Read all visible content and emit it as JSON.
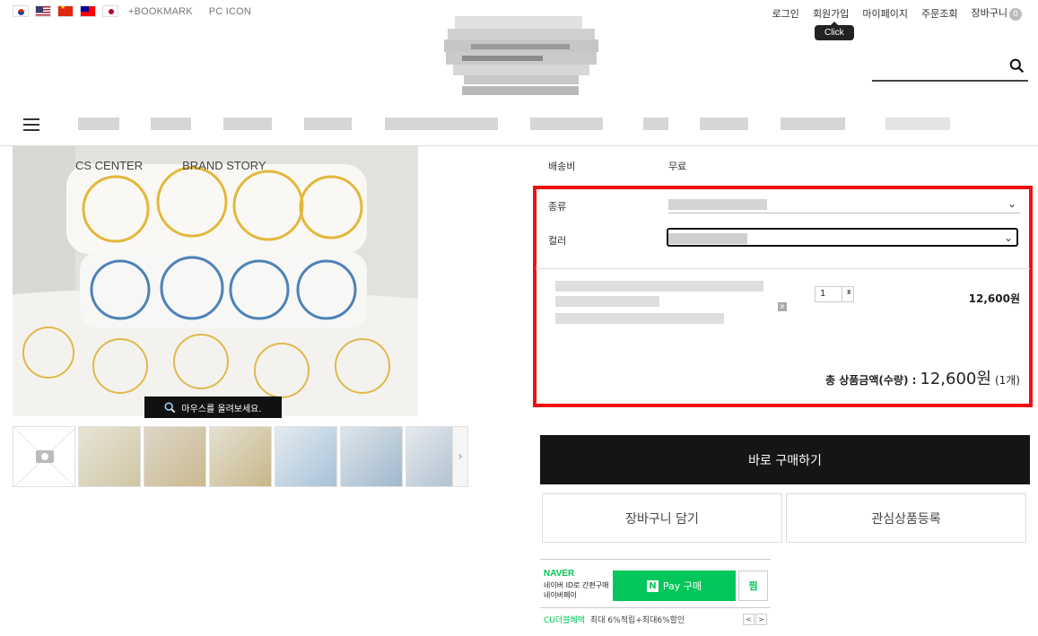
{
  "header": {
    "flags": [
      "kr",
      "us",
      "cn",
      "tw",
      "jp"
    ],
    "util_links": [
      "+BOOKMARK",
      "PC ICON"
    ],
    "top_nav": [
      "로그인",
      "회원가입",
      "마이페이지",
      "주문조회",
      "장바구니"
    ],
    "cart_count": "0",
    "tooltip": "Click",
    "search_placeholder": ""
  },
  "image_area": {
    "overlay_links": [
      "CS CENTER",
      "BRAND STORY"
    ],
    "zoom_tip": "마우스를 올려보세요."
  },
  "info": {
    "shipping_label": "배송비",
    "shipping_value": "무료",
    "option_type_label": "종류",
    "option_color_label": "컬러",
    "quantity": "1",
    "line_price": "12,600원",
    "total_label": "총 상품금액(수량) :",
    "total_amount": "12,600원",
    "total_count": "(1개)"
  },
  "actions": {
    "buy_now": "바로 구매하기",
    "add_cart": "장바구니 담기",
    "wishlist": "관심상품등록"
  },
  "naver_pay": {
    "brand": "NAVER",
    "sub_text": "네이버 ID로 간편구매 네이버페이",
    "pay_button": "Pay 구매",
    "n_logo": "N",
    "zzim": "찜",
    "benefit_label": "CU더블혜택",
    "benefit_text": "최대 6%적립+최대6%할인"
  }
}
